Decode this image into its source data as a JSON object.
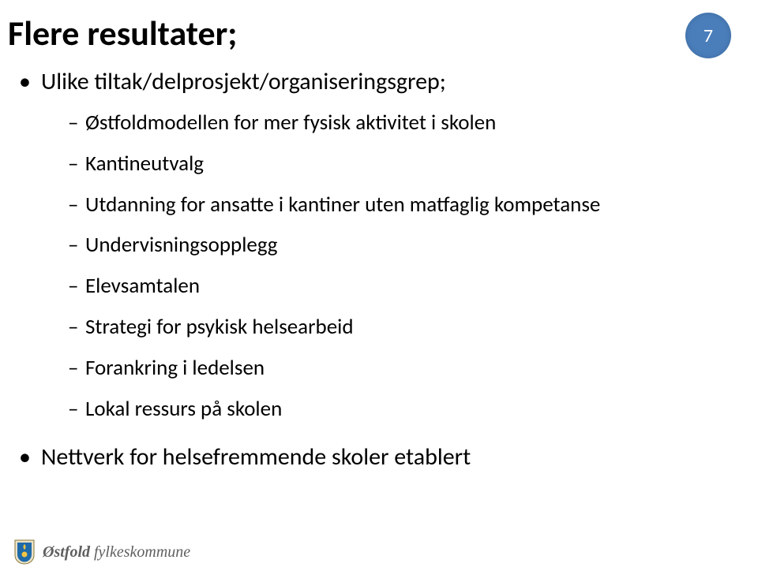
{
  "title": "Flere resultater;",
  "page_number": "7",
  "bullets": [
    {
      "text": "Ulike tiltak/delprosjekt/organiseringsgrep;",
      "sub": [
        "Østfoldmodellen for mer fysisk aktivitet i  skolen",
        "Kantineutvalg",
        "Utdanning for ansatte i kantiner uten matfaglig kompetanse",
        "Undervisningsopplegg",
        "Elevsamtalen",
        "Strategi for psykisk helsearbeid",
        "Forankring i ledelsen",
        "Lokal ressurs på skolen"
      ]
    },
    {
      "text": "Nettverk for helsefremmende skoler etablert",
      "sub": []
    }
  ],
  "brand": {
    "name_bold": "Østfold",
    "name_rest": " fylkeskommune"
  }
}
